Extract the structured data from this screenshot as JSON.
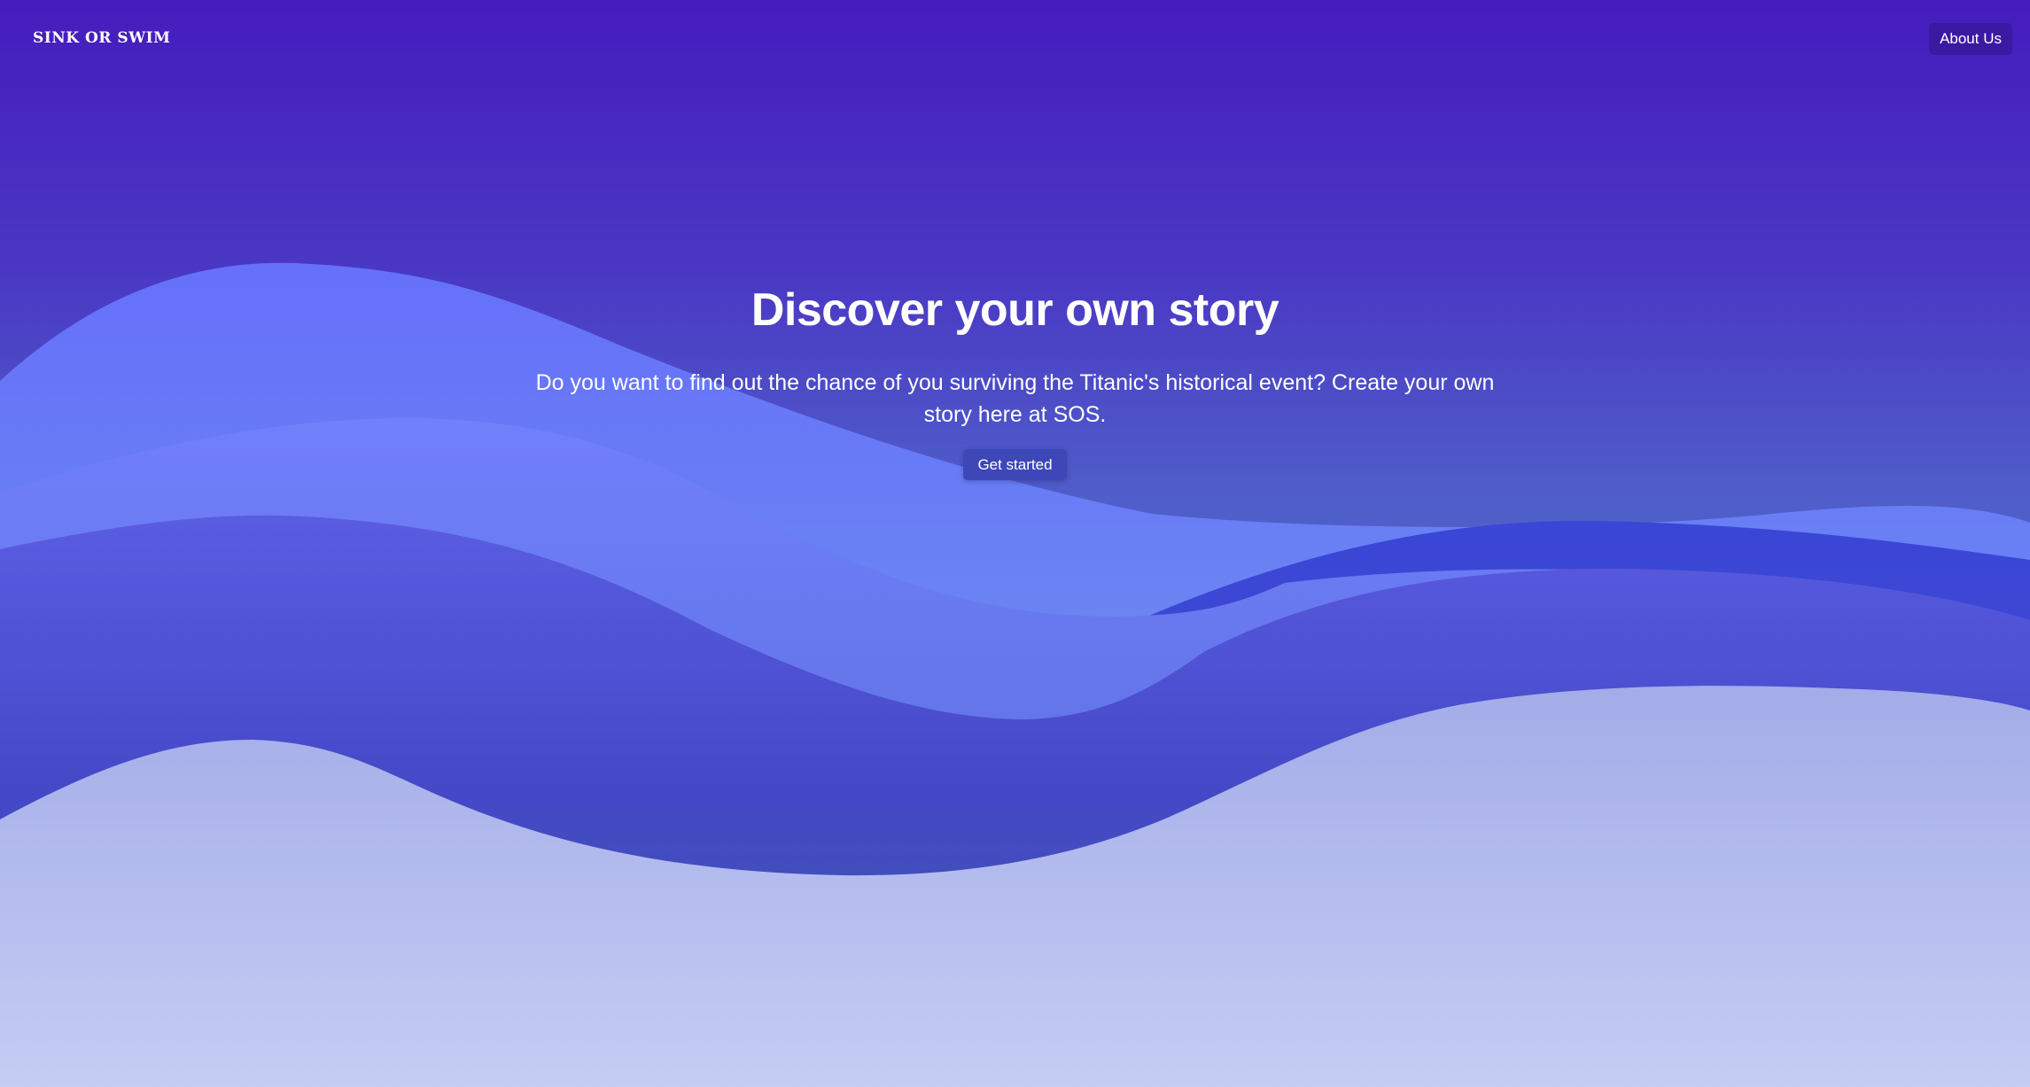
{
  "header": {
    "logo_text": "SINK OR SWIM",
    "about_label": "About Us"
  },
  "hero": {
    "title": "Discover your own story",
    "description": "Do you want to find out the chance of you surviving the Titanic's historical event? Create your own story here at SOS.",
    "cta_label": "Get started"
  },
  "colors": {
    "background_top": "#451cbd",
    "wave_light_blue": "#6b8ee8",
    "wave_periwinkle": "#6c73ec",
    "wave_deep": "#3b4dc0",
    "wave_pale": "#b6bdee",
    "button_about": "#3a1aa2",
    "button_cta": "#3d47b8"
  }
}
